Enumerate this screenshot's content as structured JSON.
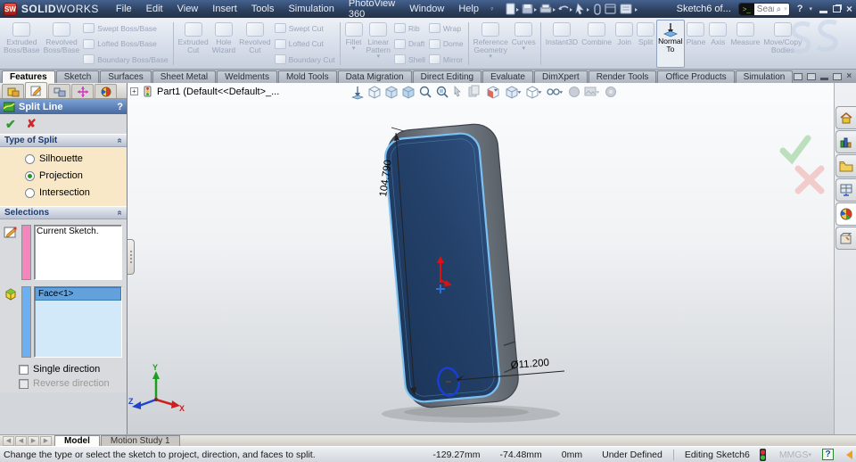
{
  "glyphs": {
    "dropdown": "▾",
    "check": "✔",
    "cross": "✘",
    "question": "?",
    "plus": "+",
    "chevron_collapse": "«",
    "close": "×",
    "search_prompt": ">_",
    "magnifier": "⌕",
    "nav_prev": "◀",
    "nav_next": "▶"
  },
  "titlebar": {
    "logo": "SW",
    "app_name_bold": "SOLID",
    "app_name_light": "WORKS",
    "menus": [
      "File",
      "Edit",
      "View",
      "Insert",
      "Tools",
      "Simulation",
      "PhotoView 360",
      "Window",
      "Help"
    ],
    "document_title": "Sketch6 of...",
    "search": {
      "placeholder": "Search Commands"
    }
  },
  "ribbon": {
    "boss_large": [
      {
        "l1": "Extruded",
        "l2": "Boss/Base"
      },
      {
        "l1": "Revolved",
        "l2": "Boss/Base"
      }
    ],
    "boss_stack": [
      "Swept Boss/Base",
      "Lofted Boss/Base",
      "Boundary Boss/Base"
    ],
    "cut_large": [
      {
        "l1": "Extruded",
        "l2": "Cut"
      },
      {
        "l1": "Hole",
        "l2": "Wizard"
      },
      {
        "l1": "Revolved",
        "l2": "Cut"
      }
    ],
    "cut_stack": [
      "Swept Cut",
      "Lofted Cut",
      "Boundary Cut"
    ],
    "feat_large": [
      {
        "l1": "Fillet",
        "l2": ""
      },
      {
        "l1": "Linear",
        "l2": "Pattern"
      }
    ],
    "feat_stack1": [
      "Rib",
      "Draft",
      "Shell"
    ],
    "feat_stack2": [
      "Wrap",
      "Dome",
      "Mirror"
    ],
    "ref_large": [
      {
        "l1": "Reference",
        "l2": "Geometry"
      },
      {
        "l1": "Curves",
        "l2": ""
      }
    ],
    "right_buttons": [
      {
        "l1": "Instant3D",
        "l2": ""
      },
      {
        "l1": "Combine",
        "l2": ""
      },
      {
        "l1": "Join",
        "l2": ""
      },
      {
        "l1": "Split",
        "l2": ""
      },
      {
        "l1": "Normal",
        "l2": "To"
      },
      {
        "l1": "Plane",
        "l2": ""
      },
      {
        "l1": "Axis",
        "l2": ""
      },
      {
        "l1": "Measure",
        "l2": ""
      },
      {
        "l1": "Move/Copy",
        "l2": "Bodies"
      }
    ]
  },
  "command_tabs": {
    "items": [
      "Features",
      "Sketch",
      "Surfaces",
      "Sheet Metal",
      "Weldments",
      "Mold Tools",
      "Data Migration",
      "Direct Editing",
      "Evaluate",
      "DimXpert",
      "Render Tools",
      "Office Products",
      "Simulation"
    ],
    "active": "Features"
  },
  "property_manager": {
    "title": "Split Line",
    "type_of_split": {
      "label": "Type of Split",
      "options": [
        "Silhouette",
        "Projection",
        "Intersection"
      ],
      "selected": "Projection"
    },
    "selections": {
      "label": "Selections",
      "sketch_item": "Current Sketch.",
      "face_item": "Face<1>",
      "single_direction_label": "Single direction",
      "reverse_direction_label": "Reverse direction"
    }
  },
  "viewport": {
    "feature_tree_label": "Part1  (Default<<Default>_...",
    "dim_length": "104.790",
    "dim_diameter": "Ø11.200",
    "triad": {
      "x": "X",
      "y": "Y",
      "z": "Z"
    }
  },
  "bottom_tabs": {
    "model": "Model",
    "motion": "Motion Study 1"
  },
  "statusbar": {
    "message": "Change the type or select the sketch to project, direction, and faces to split.",
    "coord_x": "-129.27mm",
    "coord_y": "-74.48mm",
    "coord_z": "0mm",
    "define_state": "Under Defined",
    "editing": "Editing Sketch6",
    "units": "MMGS"
  },
  "colors": {
    "titlebar_blue": "#2c3f5d",
    "screen_navy": "#223f63",
    "edge_blue": "#7cc1f2",
    "band_gray": "#6b7178",
    "selection_pink": "#f585bd",
    "selection_blue": "#6cb0f2",
    "group_peach": "#f8e8c8",
    "pm_header_blue": "#5a82b8"
  }
}
